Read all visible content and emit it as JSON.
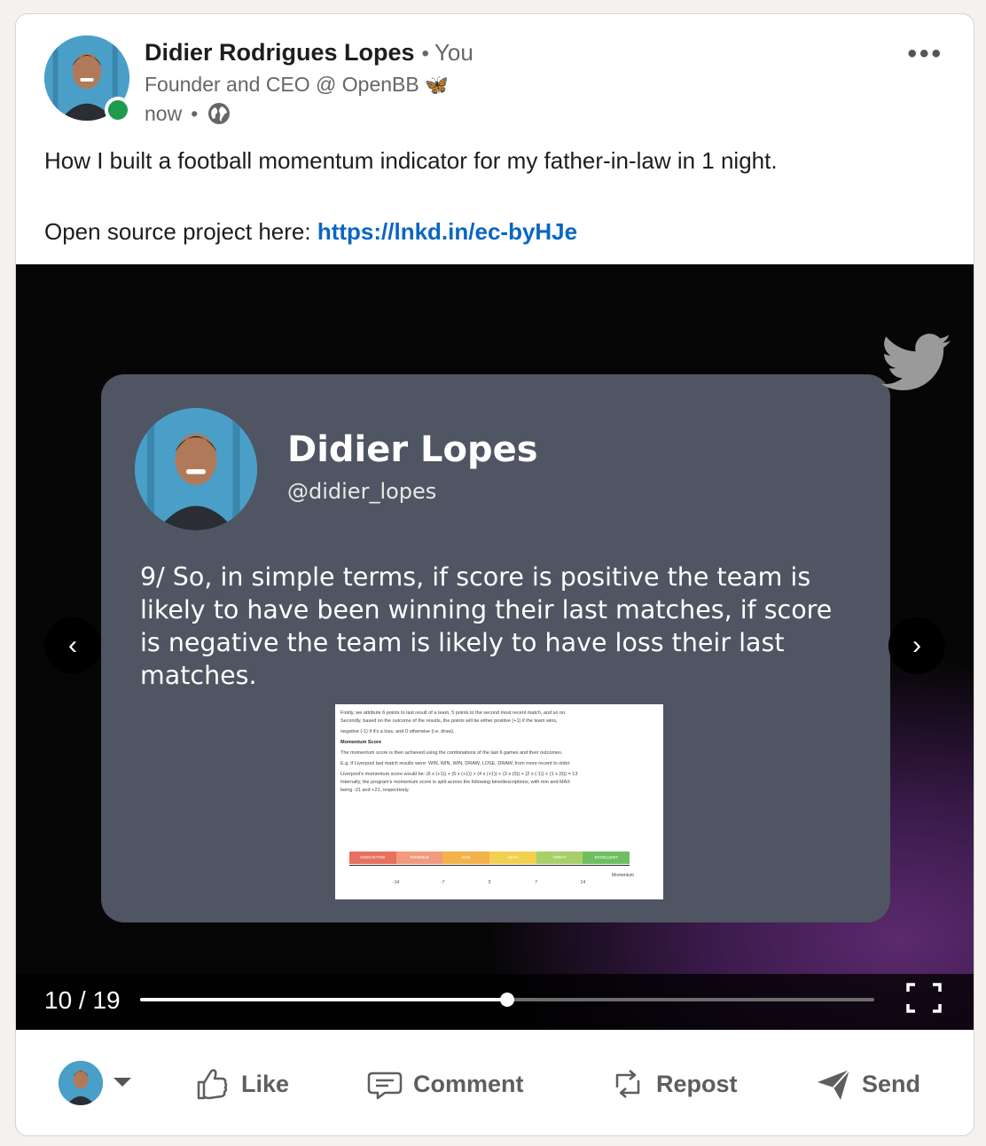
{
  "post": {
    "author_name": "Didier Rodrigues Lopes",
    "relationship": "You",
    "headline": "Founder and CEO @ OpenBB",
    "headline_emoji": "🦋",
    "time": "now",
    "text_line_1": "How I built a football momentum indicator for my father-in-law in 1 night.",
    "text_line_2_prefix": "Open source project here: ",
    "link": "https://lnkd.in/ec-byHJe"
  },
  "slide": {
    "name": "Didier Lopes",
    "handle": "@didier_lopes",
    "text": "9/ So, in simple terms, if score is positive the team is likely to have been winning their last matches, if score is negative the team is likely to have loss their last matches.",
    "doc_lines": [
      "Firstly, we attribute 6 points to last result of a team, 5 points to the second most recent match, and so on.",
      "Secondly, based on the outcome of the results, the points will be either positive (+1) if the team wins,",
      "negative (-1) if it's a loss, and 0 otherwise (i.e. draw).",
      "Momentum Score",
      "The momentum score is then achieved using the combinations of the last 6 games and their outcomes.",
      "E.g. If Liverpool last match results were: WIN, WIN, WIN, DRAW, LOSE, DRAW, from more recent to older.",
      "Liverpool's momentum score would be: (6 x (+1)) + (5 x (+1)) + (4 x (+1)) + (3 x (0)) + (2 x (-1)) + (1 x (0)) = 13",
      "Internally, the program's momentum score is split across the following bins/descriptions, with min and MAX",
      "being -21 and +21, respectively."
    ],
    "scale_labels": [
      "DISGUSTING",
      "TERRIBLE",
      "BAD",
      "OKAY",
      "GREAT",
      "EXCELLENT"
    ],
    "scale_colors": [
      "#e8705f",
      "#f09a7e",
      "#f3b24a",
      "#f2cf4f",
      "#a9cf6a",
      "#6fbf62"
    ],
    "scale_ticks": [
      "-14",
      "-7",
      "0",
      "7",
      "14"
    ],
    "axis_label": "Momentum"
  },
  "carousel": {
    "current": 10,
    "total": 19,
    "counter": "10 / 19",
    "progress": 0.5
  },
  "actions": {
    "like": "Like",
    "comment": "Comment",
    "repost": "Repost",
    "send": "Send"
  },
  "colors": {
    "link": "#0a66c2",
    "presence": "#1d9a4f",
    "slide_bg": "#4f5562"
  }
}
